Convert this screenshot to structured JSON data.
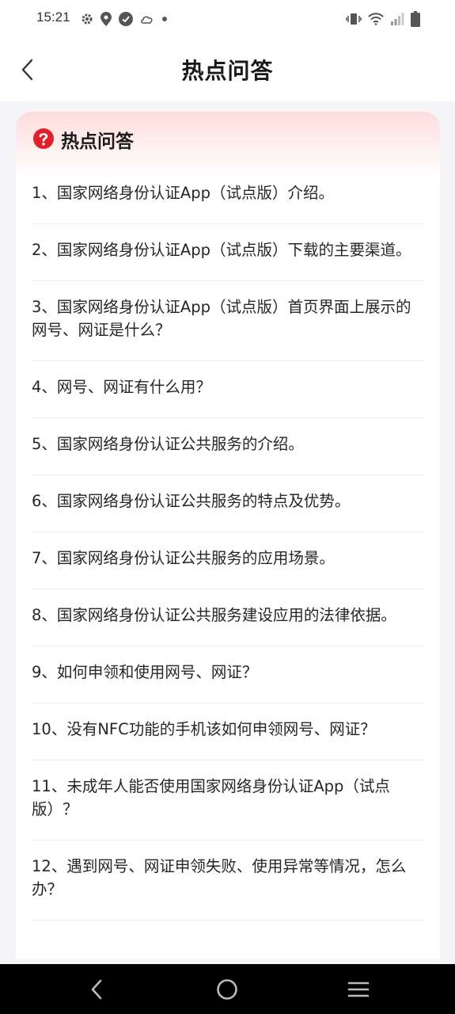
{
  "status_bar": {
    "time": "15:21",
    "left_icons": [
      "gear-icon",
      "location-pin-icon",
      "check-circle-icon",
      "cloud-icon",
      "dot-icon"
    ],
    "right_icons": [
      "vibrate-icon",
      "wifi-icon",
      "signal-icon",
      "battery-icon"
    ]
  },
  "header": {
    "title": "热点问答"
  },
  "card": {
    "title": "热点问答",
    "items": [
      "1、国家网络身份认证App（试点版）介绍。",
      "2、国家网络身份认证App（试点版）下载的主要渠道。",
      "3、国家网络身份认证App（试点版）首页界面上展示的网号、网证是什么？",
      "4、网号、网证有什么用？",
      "5、国家网络身份认证公共服务的介绍。",
      "6、国家网络身份认证公共服务的特点及优势。",
      "7、国家网络身份认证公共服务的应用场景。",
      "8、国家网络身份认证公共服务建设应用的法律依据。",
      "9、如何申领和使用网号、网证？",
      "10、没有NFC功能的手机该如何申领网号、网证？",
      "11、未成年人能否使用国家网络身份认证App（试点版）？",
      "12、遇到网号、网证申领失败、使用异常等情况，怎么办？"
    ]
  },
  "colors": {
    "accent_red": "#e0202a",
    "header_gradient_top": "#fddcdc",
    "page_background": "#f5f5f8"
  },
  "nav_bar": {
    "icons": [
      "back-triangle-icon",
      "home-circle-icon",
      "recents-menu-icon"
    ]
  }
}
